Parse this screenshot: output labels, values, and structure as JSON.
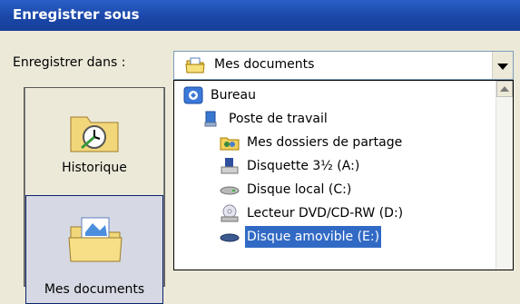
{
  "dialog": {
    "title": "Enregistrer sous",
    "save_in_label": "Enregistrer dans :",
    "save_in_value": "Mes documents"
  },
  "places": [
    {
      "label": "Historique",
      "icon": "history-folder-icon"
    },
    {
      "label": "Mes documents",
      "icon": "my-documents-folder-icon"
    }
  ],
  "dropdown": {
    "items": [
      {
        "label": "Bureau",
        "icon": "desktop-icon"
      },
      {
        "label": "Poste de travail",
        "icon": "my-computer-icon"
      },
      {
        "label": "Mes dossiers de partage",
        "icon": "shared-folders-icon"
      },
      {
        "label": "Disquette 3½ (A:)",
        "icon": "floppy-drive-icon"
      },
      {
        "label": "Disque local (C:)",
        "icon": "hard-drive-icon"
      },
      {
        "label": "Lecteur DVD/CD-RW (D:)",
        "icon": "dvd-drive-icon"
      },
      {
        "label": "Disque amovible (E:)",
        "icon": "removable-drive-icon",
        "selected": true
      }
    ]
  },
  "colors": {
    "title_bar": "#1b47a8",
    "selection": "#316ac5",
    "dialog_bg": "#ece9d8"
  }
}
